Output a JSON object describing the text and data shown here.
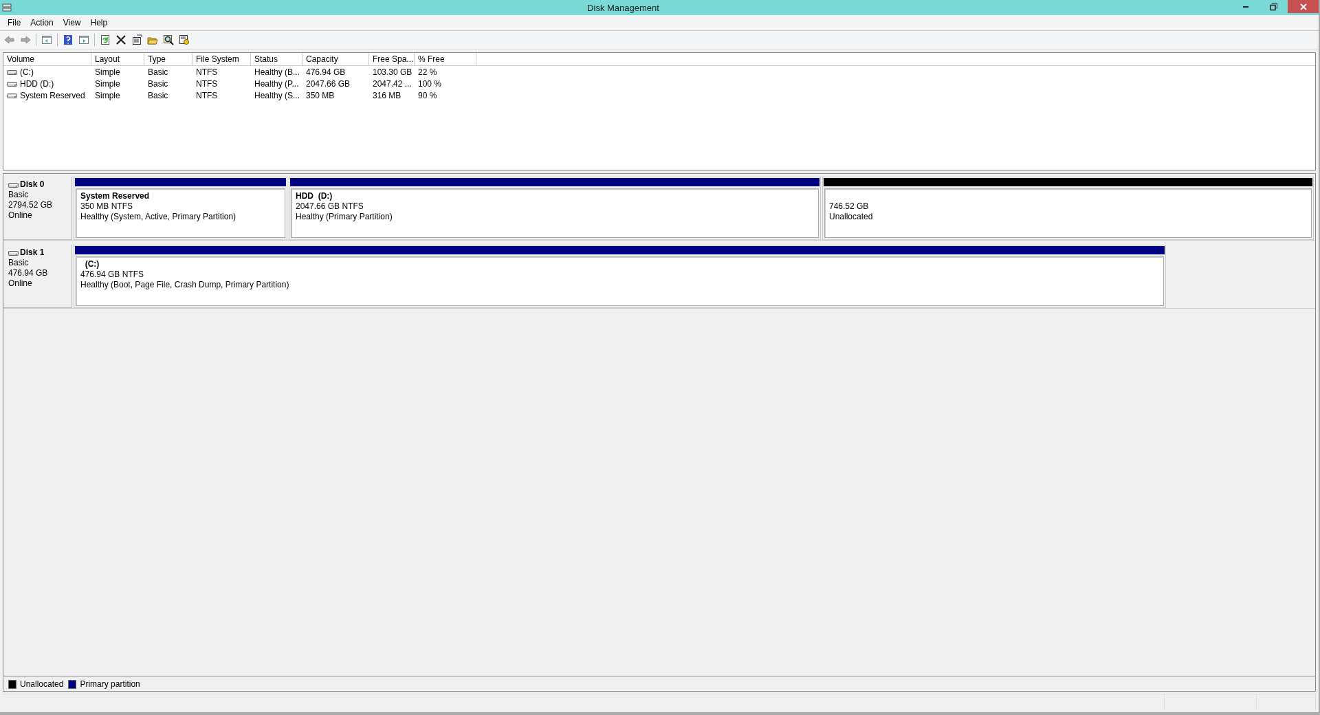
{
  "window": {
    "title": "Disk Management"
  },
  "menu": [
    "File",
    "Action",
    "View",
    "Help"
  ],
  "volumes": {
    "columns": [
      "Volume",
      "Layout",
      "Type",
      "File System",
      "Status",
      "Capacity",
      "Free Spa...",
      "% Free"
    ],
    "rows": [
      [
        "(C:)",
        "Simple",
        "Basic",
        "NTFS",
        "Healthy (B...",
        "476.94 GB",
        "103.30 GB",
        "22 %"
      ],
      [
        "HDD (D:)",
        "Simple",
        "Basic",
        "NTFS",
        "Healthy (P...",
        "2047.66 GB",
        "2047.42 ...",
        "100 %"
      ],
      [
        "System Reserved",
        "Simple",
        "Basic",
        "NTFS",
        "Healthy (S...",
        "350 MB",
        "316 MB",
        "90 %"
      ]
    ]
  },
  "disks": [
    {
      "name": "Disk 0",
      "type": "Basic",
      "size": "2794.52 GB",
      "state": "Online",
      "partitions": [
        {
          "name": "System Reserved",
          "size": "350 MB NTFS",
          "status": "Healthy (System, Active, Primary Partition)",
          "color": "#000080"
        },
        {
          "name": "HDD  (D:)",
          "size": "2047.66 GB NTFS",
          "status": "Healthy (Primary Partition)",
          "color": "#000080"
        },
        {
          "size": "746.52 GB",
          "status": "Unallocated",
          "color": "#000000"
        }
      ]
    },
    {
      "name": "Disk 1",
      "type": "Basic",
      "size": "476.94 GB",
      "state": "Online",
      "partitions": [
        {
          "name": "  (C:)",
          "size": "476.94 GB NTFS",
          "status": "Healthy (Boot, Page File, Crash Dump, Primary Partition)",
          "color": "#000080"
        }
      ]
    }
  ],
  "legend": [
    {
      "label": "Unallocated",
      "color": "#000000"
    },
    {
      "label": "Primary partition",
      "color": "#000080"
    }
  ]
}
